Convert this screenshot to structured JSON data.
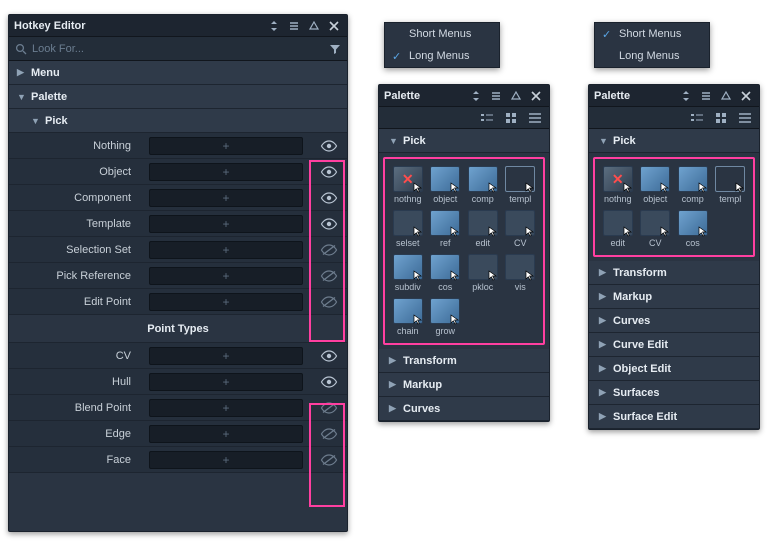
{
  "hotkey_editor": {
    "title": "Hotkey Editor",
    "search_placeholder": "Look For...",
    "section_menu": "Menu",
    "section_palette": "Palette",
    "section_pick": "Pick",
    "items": [
      {
        "label": "Nothing",
        "visible": true
      },
      {
        "label": "Object",
        "visible": true
      },
      {
        "label": "Component",
        "visible": true
      },
      {
        "label": "Template",
        "visible": true
      },
      {
        "label": "Selection Set",
        "visible": false
      },
      {
        "label": "Pick Reference",
        "visible": false
      },
      {
        "label": "Edit Point",
        "visible": false
      }
    ],
    "sub_header": "Point Types",
    "items2": [
      {
        "label": "CV",
        "visible": true
      },
      {
        "label": "Hull",
        "visible": true
      },
      {
        "label": "Blend Point",
        "visible": false
      },
      {
        "label": "Edge",
        "visible": false
      },
      {
        "label": "Face",
        "visible": false
      }
    ]
  },
  "menu1": {
    "short": "Short Menus",
    "long": "Long Menus",
    "checked": "long"
  },
  "menu2": {
    "short": "Short Menus",
    "long": "Long Menus",
    "checked": "short"
  },
  "palette1": {
    "title": "Palette",
    "section_pick": "Pick",
    "grid": [
      {
        "label": "nothng",
        "kind": "red"
      },
      {
        "label": "object",
        "kind": "cube"
      },
      {
        "label": "comp",
        "kind": "cube"
      },
      {
        "label": "templ",
        "kind": "wire"
      },
      {
        "label": "selset",
        "kind": "flat"
      },
      {
        "label": "ref",
        "kind": "cube"
      },
      {
        "label": "edit",
        "kind": "flat"
      },
      {
        "label": "CV",
        "kind": "flat"
      },
      {
        "label": "subdiv",
        "kind": "cube"
      },
      {
        "label": "cos",
        "kind": "cube"
      },
      {
        "label": "pkloc",
        "kind": "flat"
      },
      {
        "label": "vis",
        "kind": "flat"
      },
      {
        "label": "chain",
        "kind": "cube"
      },
      {
        "label": "grow",
        "kind": "cube"
      }
    ],
    "sections": [
      "Transform",
      "Markup",
      "Curves"
    ]
  },
  "palette2": {
    "title": "Palette",
    "section_pick": "Pick",
    "grid": [
      {
        "label": "nothng",
        "kind": "red"
      },
      {
        "label": "object",
        "kind": "cube"
      },
      {
        "label": "comp",
        "kind": "cube"
      },
      {
        "label": "templ",
        "kind": "wire"
      },
      {
        "label": "edit",
        "kind": "flat"
      },
      {
        "label": "CV",
        "kind": "flat"
      },
      {
        "label": "cos",
        "kind": "cube"
      }
    ],
    "sections": [
      "Transform",
      "Markup",
      "Curves",
      "Curve Edit",
      "Object Edit",
      "Surfaces",
      "Surface Edit"
    ]
  }
}
